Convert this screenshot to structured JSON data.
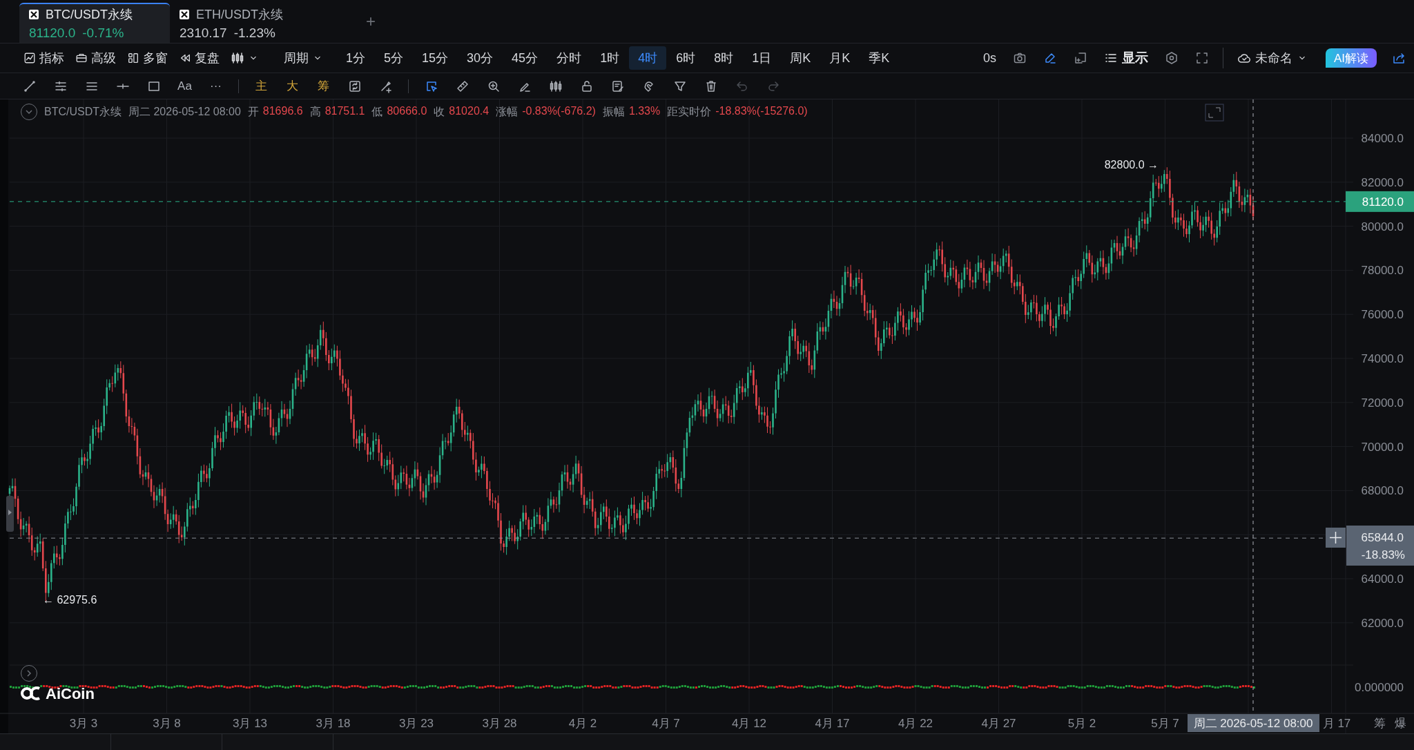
{
  "tabs": [
    {
      "symbol": "BTC/USDT永续",
      "price": "81120.0",
      "change": "-0.71%",
      "selected": true
    },
    {
      "symbol": "ETH/USDT永续",
      "price": "2310.17",
      "change": "-1.23%",
      "selected": false
    }
  ],
  "new_tab_label": "+",
  "toolbar": {
    "menus": [
      {
        "kind": "indicator",
        "label": "指标"
      },
      {
        "kind": "advanced",
        "label": "高级"
      },
      {
        "kind": "multi_window",
        "label": "多窗"
      },
      {
        "kind": "replay",
        "label": "复盘"
      },
      {
        "kind": "chart_type"
      },
      {
        "kind": "period",
        "label": "周期"
      }
    ],
    "timeframes": [
      {
        "label": "1分",
        "selected": false
      },
      {
        "label": "5分",
        "selected": false
      },
      {
        "label": "15分",
        "selected": false
      },
      {
        "label": "30分",
        "selected": false
      },
      {
        "label": "45分",
        "selected": false
      },
      {
        "label": "分时",
        "selected": false
      },
      {
        "label": "1时",
        "selected": false
      },
      {
        "label": "4时",
        "selected": true
      },
      {
        "label": "6时",
        "selected": false
      },
      {
        "label": "8时",
        "selected": false
      },
      {
        "label": "1日",
        "selected": false
      },
      {
        "label": "周K",
        "selected": false
      },
      {
        "label": "月K",
        "selected": false
      },
      {
        "label": "季K",
        "selected": false
      }
    ],
    "countdown": "0s",
    "pen_active": true,
    "display_label": "显示",
    "layout_name": "未命名",
    "ai_button": "AI解读"
  },
  "drawing_tool_groups": [
    [
      {
        "kind": "trendline",
        "selected": false,
        "disabled": false
      },
      {
        "kind": "parallel",
        "selected": false,
        "disabled": false
      },
      {
        "kind": "lines",
        "selected": false,
        "disabled": false
      },
      {
        "kind": "hline",
        "selected": false,
        "disabled": false
      },
      {
        "kind": "rect",
        "selected": false,
        "disabled": false
      },
      {
        "kind": "text",
        "label": "Aa",
        "selected": false,
        "disabled": false
      },
      {
        "kind": "text",
        "label": "···",
        "selected": false,
        "disabled": false
      }
    ],
    [
      {
        "kind": "layer",
        "label": "主",
        "selected": false,
        "disabled": false
      },
      {
        "kind": "layer",
        "label": "大",
        "selected": false,
        "disabled": false
      },
      {
        "kind": "layer",
        "label": "筹",
        "selected": false,
        "disabled": false
      },
      {
        "kind": "cycle",
        "selected": false,
        "disabled": false
      },
      {
        "kind": "brush",
        "selected": false,
        "disabled": false
      }
    ],
    [
      {
        "kind": "cursor",
        "selected": true,
        "disabled": false
      },
      {
        "kind": "ruler",
        "selected": false,
        "disabled": false
      },
      {
        "kind": "zoom",
        "selected": false,
        "disabled": false
      },
      {
        "kind": "eraser",
        "selected": false,
        "disabled": false
      },
      {
        "kind": "candles",
        "selected": false,
        "disabled": false
      },
      {
        "kind": "lock",
        "selected": false,
        "disabled": false
      },
      {
        "kind": "note",
        "selected": false,
        "disabled": false
      },
      {
        "kind": "magnet",
        "selected": false,
        "disabled": false
      },
      {
        "kind": "filter",
        "selected": false,
        "disabled": false
      },
      {
        "kind": "trash",
        "selected": false,
        "disabled": false
      },
      {
        "kind": "undo",
        "selected": false,
        "disabled": true
      },
      {
        "kind": "redo",
        "selected": false,
        "disabled": true
      }
    ]
  ],
  "info_bar": {
    "symbol": "BTC/USDT永续",
    "time": "周二 2026-05-12 08:00",
    "fields": [
      {
        "label": "开",
        "value": "81696.6"
      },
      {
        "label": "高",
        "value": "81751.1"
      },
      {
        "label": "低",
        "value": "80666.0"
      },
      {
        "label": "收",
        "value": "81020.4"
      },
      {
        "label": "涨幅",
        "value": "-0.83%(-676.2)"
      },
      {
        "label": "振幅",
        "value": "1.33%"
      },
      {
        "label": "距实时价",
        "value": "-18.83%(-15276.0)"
      }
    ]
  },
  "chart": {
    "price_ticks": [
      "84000.0",
      "82000.0",
      "80000.0",
      "78000.0",
      "76000.0",
      "74000.0",
      "72000.0",
      "70000.0",
      "68000.0",
      "64000.0",
      "62000.0"
    ],
    "current_price": "81120.0",
    "crosshair_price": "65844.0",
    "crosshair_change": "-18.83%",
    "high_label": "82800.0 →",
    "low_label": "← 62975.6",
    "indicator_tick": "0.000000",
    "date_ticks": [
      "3月 3",
      "3月 8",
      "3月 13",
      "3月 18",
      "3月 23",
      "3月 28",
      "4月 2",
      "4月 7",
      "4月 12",
      "4月 17",
      "4月 22",
      "4月 27",
      "5月 2",
      "5月 7"
    ],
    "crosshair_date": "周二 2026-05-12 08:00",
    "partial_date": "月 17",
    "side_labels": [
      "筹",
      "爆"
    ],
    "watermark": "AiCoin"
  }
}
